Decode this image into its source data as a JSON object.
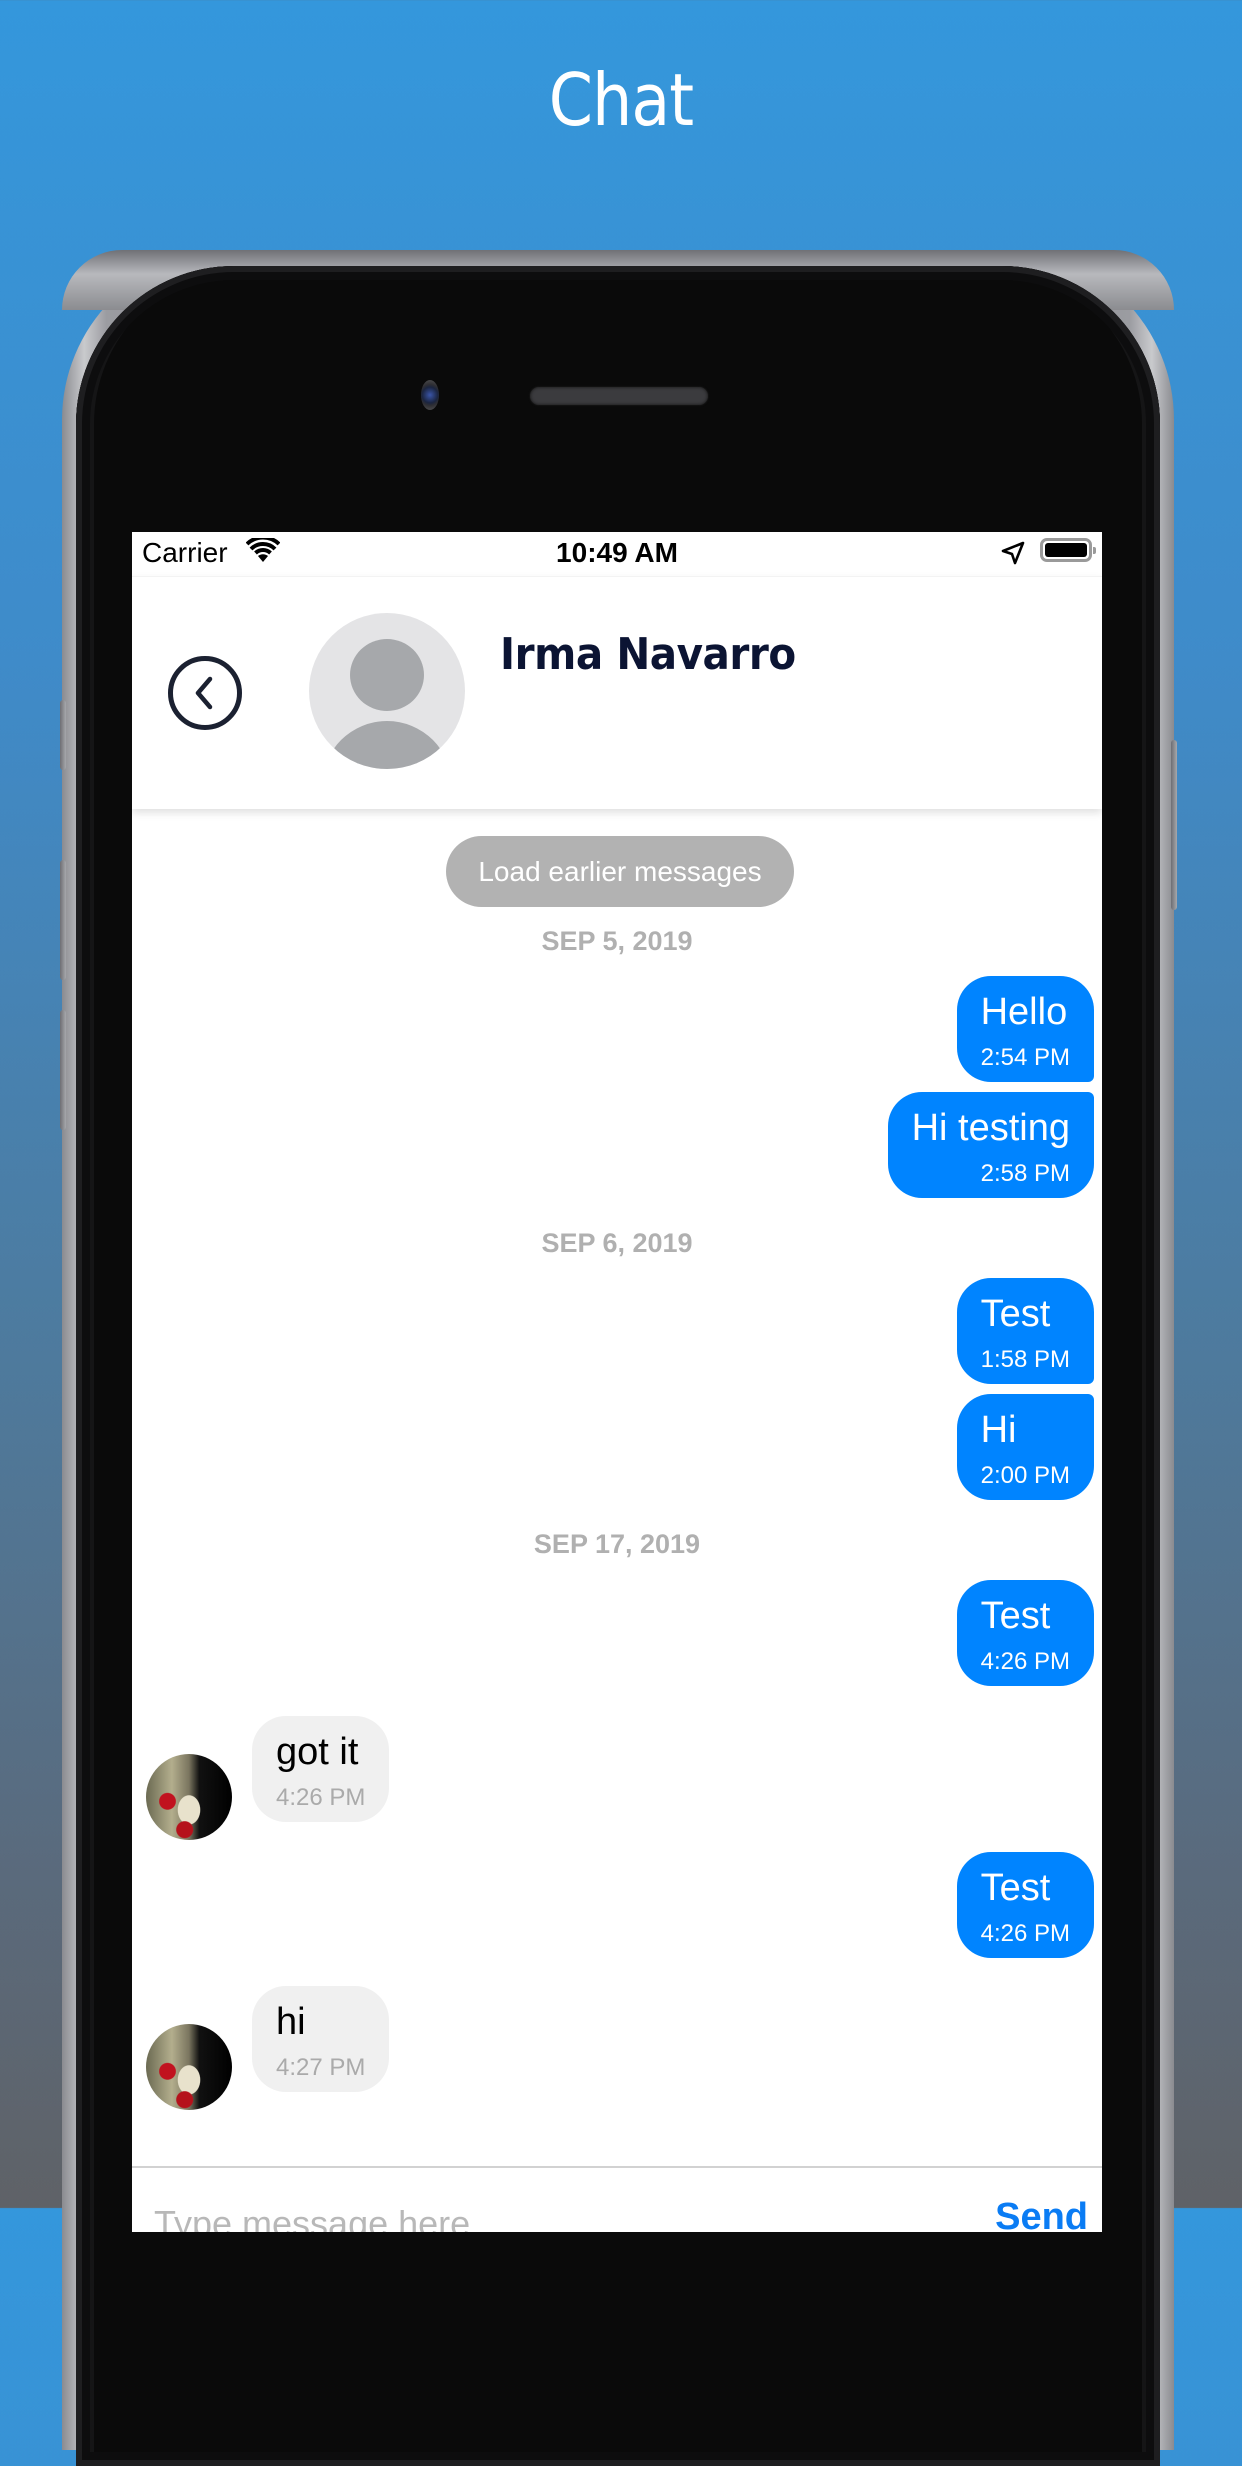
{
  "promo": {
    "title": "Chat"
  },
  "status_bar": {
    "carrier": "Carrier",
    "time": "10:49 AM"
  },
  "header": {
    "contact_name": "Irma Navarro",
    "back_icon": "chevron-left-circle-icon",
    "avatar_icon": "default-user-avatar"
  },
  "messages": {
    "load_earlier_label": "Load earlier messages",
    "date_separators": [
      "SEP 5, 2019",
      "SEP 6, 2019",
      "SEP 17, 2019"
    ],
    "items": [
      {
        "direction": "outgoing",
        "text": "Hello",
        "time": "2:54 PM",
        "date": "SEP 5, 2019"
      },
      {
        "direction": "outgoing",
        "text": "Hi testing",
        "time": "2:58 PM",
        "date": "SEP 5, 2019"
      },
      {
        "direction": "outgoing",
        "text": "Test",
        "time": "1:58 PM",
        "date": "SEP 6, 2019"
      },
      {
        "direction": "outgoing",
        "text": "Hi",
        "time": "2:00 PM",
        "date": "SEP 6, 2019"
      },
      {
        "direction": "outgoing",
        "text": "Test",
        "time": "4:26 PM",
        "date": "SEP 17, 2019"
      },
      {
        "direction": "incoming",
        "text": "got it",
        "time": "4:26 PM",
        "date": "SEP 17, 2019"
      },
      {
        "direction": "outgoing",
        "text": "Test",
        "time": "4:26 PM",
        "date": "SEP 17, 2019"
      },
      {
        "direction": "incoming",
        "text": "hi",
        "time": "4:27 PM",
        "date": "SEP 17, 2019"
      }
    ]
  },
  "composer": {
    "input_value": "",
    "placeholder": "Type message here",
    "send_label": "Send"
  },
  "colors": {
    "outgoing_bubble": "#0084ff",
    "incoming_bubble": "#f0f0f0",
    "send_button": "#0a7cf4",
    "contact_name": "#0b1433",
    "date_separator": "#b0b0b0",
    "load_earlier_pill": "#b2b2b2"
  }
}
